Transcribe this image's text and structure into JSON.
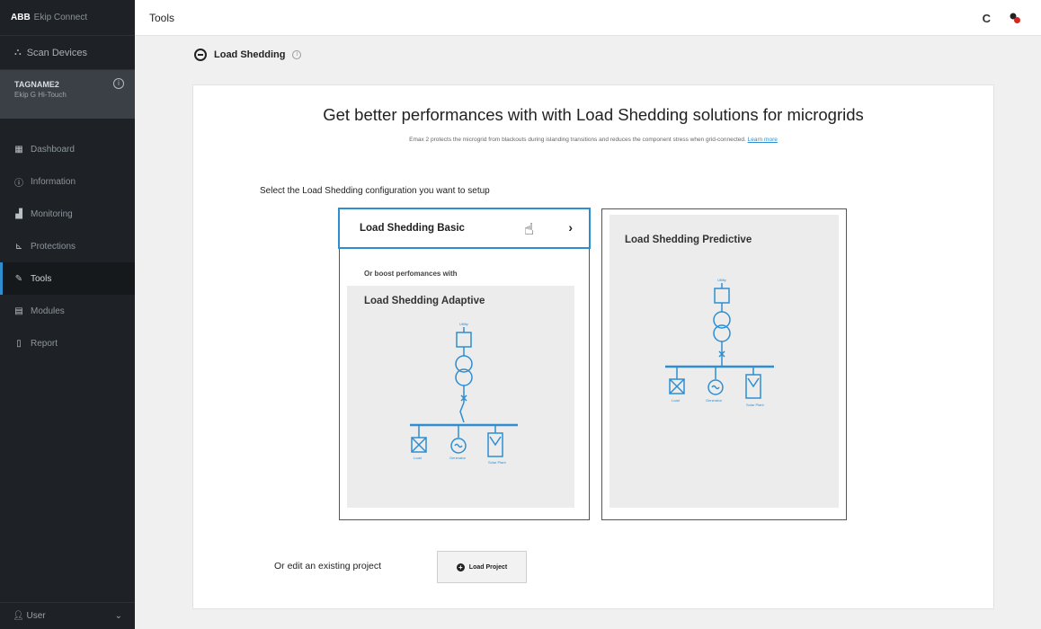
{
  "sidebar": {
    "brand": "ABB",
    "app_name": "Ekip Connect",
    "scan_label": "Scan Devices",
    "device": {
      "name": "TAGNAME2",
      "model": "Ekip G Hi-Touch"
    },
    "items": [
      {
        "label": "Dashboard",
        "icon": "dashboard-icon"
      },
      {
        "label": "Information",
        "icon": "info-icon"
      },
      {
        "label": "Monitoring",
        "icon": "chart-icon"
      },
      {
        "label": "Protections",
        "icon": "protections-icon"
      },
      {
        "label": "Tools",
        "icon": "wrench-icon"
      },
      {
        "label": "Modules",
        "icon": "modules-icon"
      },
      {
        "label": "Report",
        "icon": "report-icon"
      }
    ],
    "active_item": "Tools",
    "user": "User"
  },
  "header": {
    "title": "Tools"
  },
  "section": {
    "title": "Load Shedding"
  },
  "main": {
    "headline": "Get better performances with with Load Shedding solutions for microgrids",
    "description": "Emax 2 protects the microgrid from blackouts during islanding transitions and reduces the component stress when grid-connected.",
    "learn_more": "Learn more",
    "select_label": "Select the Load Shedding configuration you want to setup",
    "basic_title": "Load Shedding Basic",
    "boost_text": "Or boost perfomances with",
    "adaptive_title": "Load Shedding Adaptive",
    "predictive_title": "Load Shedding Predictive",
    "edit_label": "Or edit an existing project",
    "load_button": "Load Project"
  },
  "diagram_labels": {
    "utility": "Utility",
    "load": "Load",
    "generator": "Generator",
    "solar": "Solar Plant"
  },
  "colors": {
    "accent": "#2f8ed0",
    "sidebar_bg": "#1e2226",
    "alert": "#d9261c"
  }
}
